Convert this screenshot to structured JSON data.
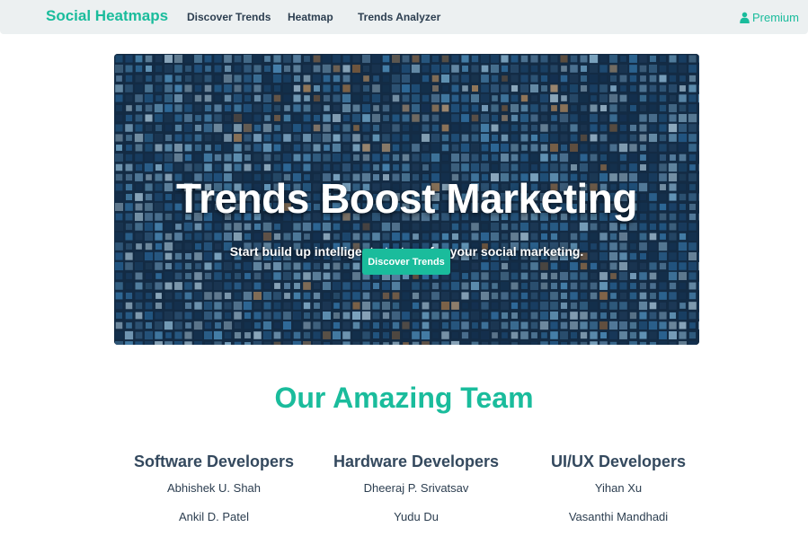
{
  "navbar": {
    "brand": "Social Heatmaps",
    "links": [
      {
        "label": "Discover Trends"
      },
      {
        "label": "Heatmap"
      },
      {
        "label": "Trends Analyzer"
      }
    ],
    "premium_label": "Premium",
    "premium_icon": "user-icon"
  },
  "hero": {
    "title": "Trends Boost Marketing",
    "subtitle": "Start build up intelligent strategy for your social marketing.",
    "button_label": "Discover Trends",
    "background": "blue-mosaic-tiles"
  },
  "team": {
    "title": "Our Amazing Team",
    "groups": [
      {
        "heading": "Software Developers",
        "members": [
          "Abhishek U. Shah",
          "Ankil D. Patel"
        ]
      },
      {
        "heading": "Hardware Developers",
        "members": [
          "Dheeraj P. Srivatsav",
          "Yudu Du"
        ]
      },
      {
        "heading": "UI/UX Developers",
        "members": [
          "Yihan Xu",
          "Vasanthi Mandhadi"
        ]
      }
    ]
  },
  "colors": {
    "accent": "#1abc9c",
    "text_dark": "#2c3e50",
    "navbar_bg": "#ecf0f1"
  }
}
